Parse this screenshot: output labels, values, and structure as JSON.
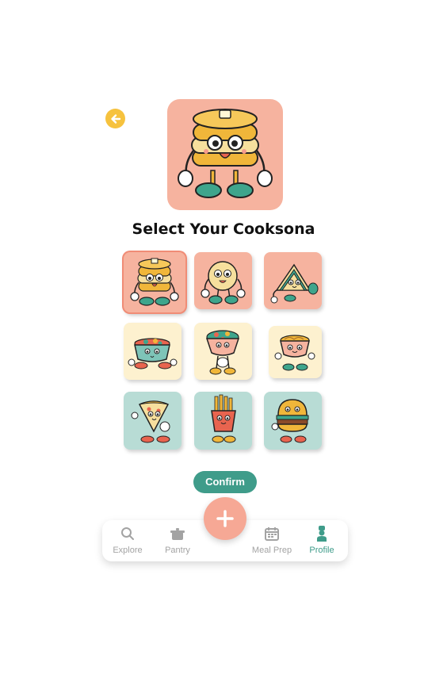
{
  "header": {
    "back_icon": "arrow-left-icon",
    "title": "Select Your Cooksona"
  },
  "hero": {
    "character": "pancake-stack",
    "background": "#f6b39f"
  },
  "cooksonas": [
    {
      "name": "pancake-stack",
      "color": "#f6b39f",
      "selected": true
    },
    {
      "name": "round-cracker",
      "color": "#f6b39f",
      "selected": false
    },
    {
      "name": "sandwich",
      "color": "#f6b39f",
      "selected": false
    },
    {
      "name": "salad-bowl",
      "color": "#fdf1cf",
      "selected": false
    },
    {
      "name": "veggie-bowl",
      "color": "#fdf1cf",
      "selected": false
    },
    {
      "name": "ramen-bowl",
      "color": "#fdf1cf",
      "selected": false
    },
    {
      "name": "pizza-slice",
      "color": "#b8dcd5",
      "selected": false
    },
    {
      "name": "fries",
      "color": "#b8dcd5",
      "selected": false
    },
    {
      "name": "burger",
      "color": "#b8dcd5",
      "selected": false
    }
  ],
  "confirm_label": "Confirm",
  "nav": {
    "explore": "Explore",
    "pantry": "Pantry",
    "add_icon": "plus-icon",
    "meal_prep": "Meal Prep",
    "profile": "Profile",
    "active": "Profile"
  },
  "colors": {
    "accent_teal": "#3f9c8a",
    "salmon": "#f6b39f",
    "back_yellow": "#f6c23e"
  }
}
